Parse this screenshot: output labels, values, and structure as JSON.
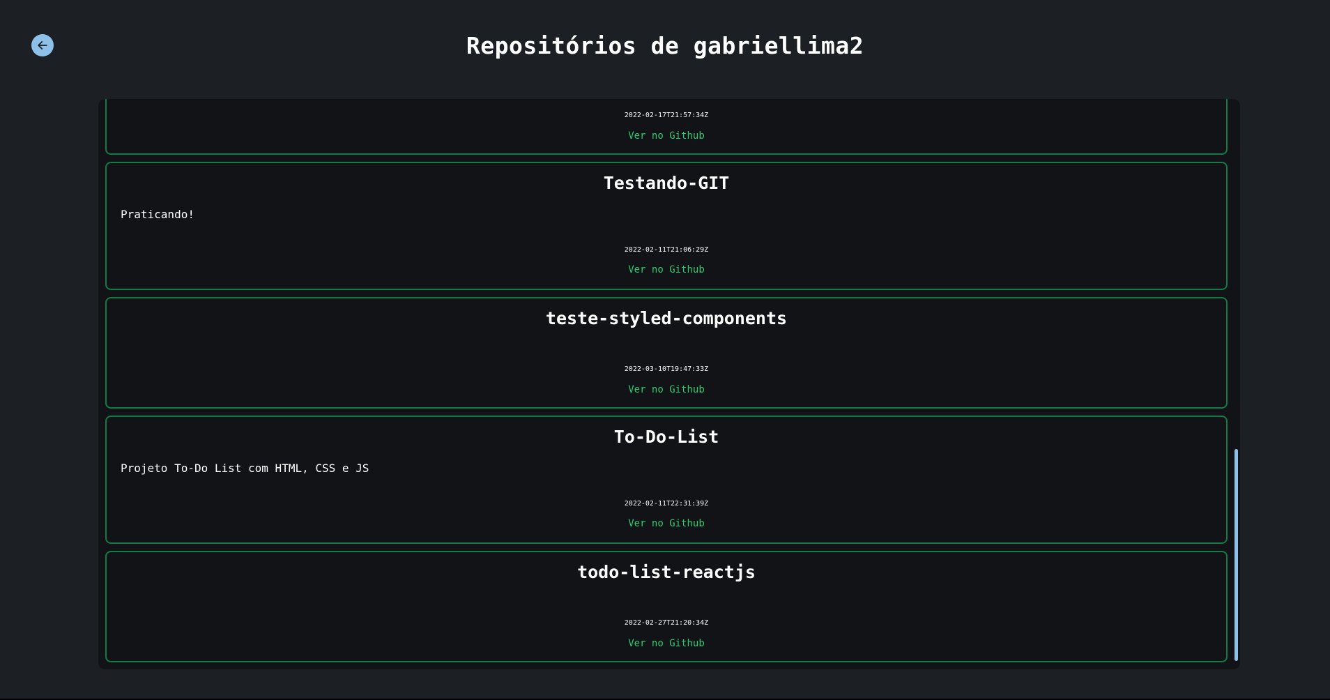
{
  "header": {
    "title": "Repositórios de gabriellima2",
    "back_icon": "arrow-left-icon",
    "accent_color": "#8ec1ea"
  },
  "repos": [
    {
      "name": "",
      "description": "",
      "date": "2022-02-17T21:57:34Z",
      "link_label": "Ver no Github"
    },
    {
      "name": "Testando-GIT",
      "description": "Praticando!",
      "date": "2022-02-11T21:06:29Z",
      "link_label": "Ver no Github"
    },
    {
      "name": "teste-styled-components",
      "description": "",
      "date": "2022-03-10T19:47:33Z",
      "link_label": "Ver no Github"
    },
    {
      "name": "To-Do-List",
      "description": "Projeto To-Do List com HTML, CSS e JS",
      "date": "2022-02-11T22:31:39Z",
      "link_label": "Ver no Github"
    },
    {
      "name": "todo-list-reactjs",
      "description": "",
      "date": "2022-02-27T21:20:34Z",
      "link_label": "Ver no Github"
    }
  ],
  "colors": {
    "background": "#1c1f24",
    "panel": "#111317",
    "card_border": "#157a4a",
    "link": "#2ecc71"
  }
}
